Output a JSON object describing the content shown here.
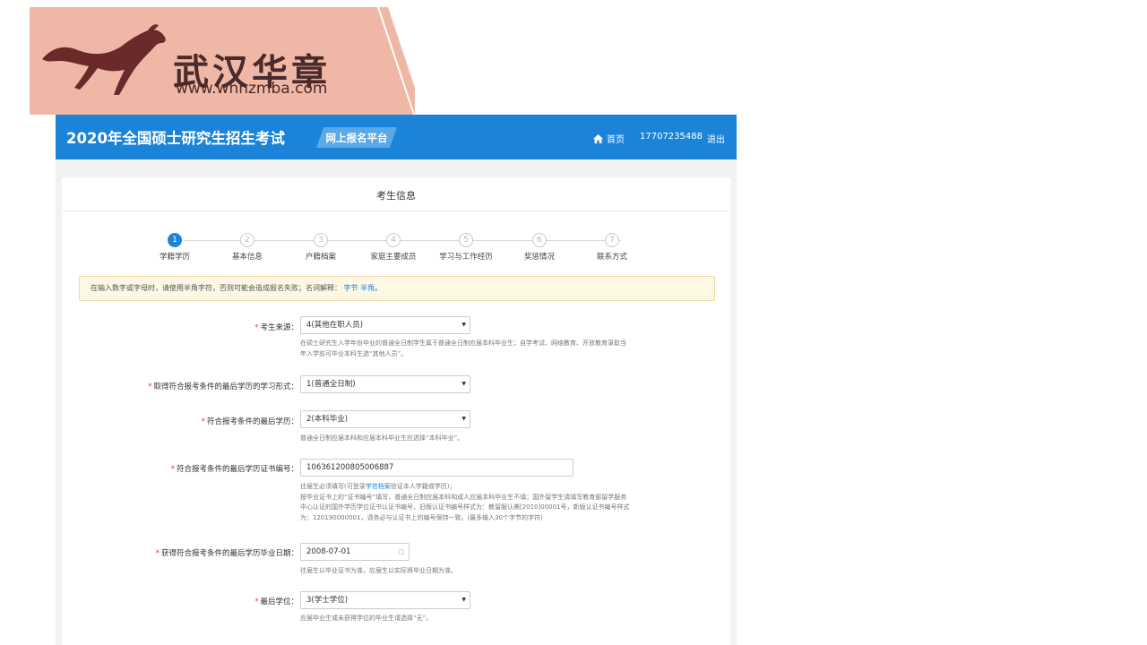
{
  "brand": {
    "name": "武汉华章",
    "url": "www.whhzmba.com",
    "color_bg": "#efb8a6",
    "color_text": "#4a2a2a"
  },
  "header": {
    "title": "2020年全国硕士研究生招生考试",
    "badge": "网上报名平台",
    "nav": {
      "home": "首页",
      "phone": "17707235488",
      "logout": "退出"
    },
    "color": "#1b84d8"
  },
  "panel": {
    "title": "考生信息",
    "steps": [
      {
        "num": "1",
        "label": "学籍学历",
        "active": true
      },
      {
        "num": "2",
        "label": "基本信息",
        "active": false
      },
      {
        "num": "3",
        "label": "户籍档案",
        "active": false
      },
      {
        "num": "4",
        "label": "家庭主要成员",
        "active": false
      },
      {
        "num": "5",
        "label": "学习与工作经历",
        "active": false
      },
      {
        "num": "6",
        "label": "奖惩情况",
        "active": false
      },
      {
        "num": "7",
        "label": "联系方式",
        "active": false
      }
    ],
    "notice": {
      "text": "在输入数字或字母时，请使用半角字符，否则可能会造成报名失败；名词解释：",
      "link1": "字节",
      "link2": "半角",
      "tail": "。"
    }
  },
  "form": {
    "source": {
      "label": "考生来源：",
      "value": "4(其他在职人员)",
      "help_line1": "在硕士研究生入学年份毕业的普通全日制学生属于普通全日制应届本科毕业生；自学考试、网络教育、开放教育录取当",
      "help_line2": "年入学前可毕业本科生选“其他人员”。"
    },
    "study_form": {
      "label": "取得符合报考条件的最后学历的学习形式：",
      "value": "1(普通全日制)"
    },
    "last_degree_edu": {
      "label": "符合报考条件的最后学历：",
      "value": "2(本科毕业)",
      "help": "普通全日制应届本科和应届本科毕业生应选择“本科毕业”。"
    },
    "cert_no": {
      "label": "符合报考条件的最后学历证书编号：",
      "value": "106361200805006887",
      "help_line1_a": "往届生必须填写(可登录",
      "help_line1_link": "学信档案",
      "help_line1_b": "验证本人学籍或学历)；",
      "help_line2": "按毕业证书上的“证书编号”填写，普通全日制应届本科和成人应届本科毕业生不填；国外留学生请填写教育部留学服务",
      "help_line3": "中心认证的国外学历学位证书认证书编号，旧版认证书编号样式为：教留服认美[2010]00001号，新版认证书编号样式",
      "help_line4": "为：120190000001，请务必与认证书上的编号保持一致。(最多输入30个字节的字符)"
    },
    "grad_date": {
      "label": "获得符合报考条件的最后学历毕业日期：",
      "value": "2008-07-01",
      "help": "往届生以毕业证书为准，应届生以实际将毕业日期为准。"
    },
    "last_degree": {
      "label": "最后学位：",
      "value": "3(学士学位)",
      "help": "应届毕业生或未获得学位的毕业生请选择“无”。"
    }
  }
}
